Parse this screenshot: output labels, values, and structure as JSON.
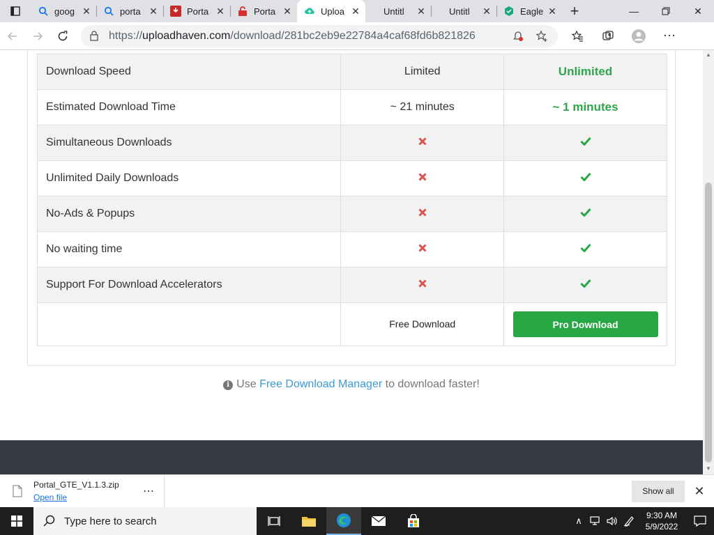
{
  "tabs": [
    {
      "title": "goog",
      "icon": "search-icon",
      "active": false
    },
    {
      "title": "porta",
      "icon": "search-icon",
      "active": false
    },
    {
      "title": "Porta",
      "icon": "yelp-icon",
      "active": false
    },
    {
      "title": "Porta",
      "icon": "lock-icon",
      "active": false
    },
    {
      "title": "Uploa",
      "icon": "uploadhaven-icon",
      "active": true
    },
    {
      "title": "Untitl",
      "icon": "blank-icon",
      "active": false
    },
    {
      "title": "Untitl",
      "icon": "blank-icon",
      "active": false
    },
    {
      "title": "Eagle",
      "icon": "eagle-icon",
      "active": false
    }
  ],
  "address": {
    "url_prefix": "https://",
    "url_host": "uploadhaven.com",
    "url_path": "/download/281bc2eb9e22784a4caf68fd6b821826"
  },
  "comparison": {
    "rows": [
      {
        "feature": "Download Speed",
        "free": "Limited",
        "pro": "Unlimited",
        "type": "text"
      },
      {
        "feature": "Estimated Download Time",
        "free": "~ 21 minutes",
        "pro": "~ 1 minutes",
        "type": "text"
      },
      {
        "feature": "Simultaneous Downloads",
        "free": false,
        "pro": true,
        "type": "check"
      },
      {
        "feature": "Unlimited Daily Downloads",
        "free": false,
        "pro": true,
        "type": "check"
      },
      {
        "feature": "No-Ads & Popups",
        "free": false,
        "pro": true,
        "type": "check"
      },
      {
        "feature": "No waiting time",
        "free": false,
        "pro": true,
        "type": "check"
      },
      {
        "feature": "Support For Download Accelerators",
        "free": false,
        "pro": true,
        "type": "check"
      }
    ],
    "free_download_label": "Free Download",
    "pro_download_label": "Pro Download"
  },
  "fdm_note": {
    "prefix": "Use ",
    "link": "Free Download Manager",
    "suffix": " to download faster!"
  },
  "download_shelf": {
    "filename": "Portal_GTE_V1.1.3.zip",
    "open_label": "Open file",
    "show_all_label": "Show all"
  },
  "taskbar": {
    "search_placeholder": "Type here to search",
    "time": "9:30 AM",
    "date": "5/9/2022"
  },
  "colors": {
    "green": "#28a745",
    "red": "#d9534f",
    "link": "#3c9ad3",
    "footer": "#363b44"
  }
}
